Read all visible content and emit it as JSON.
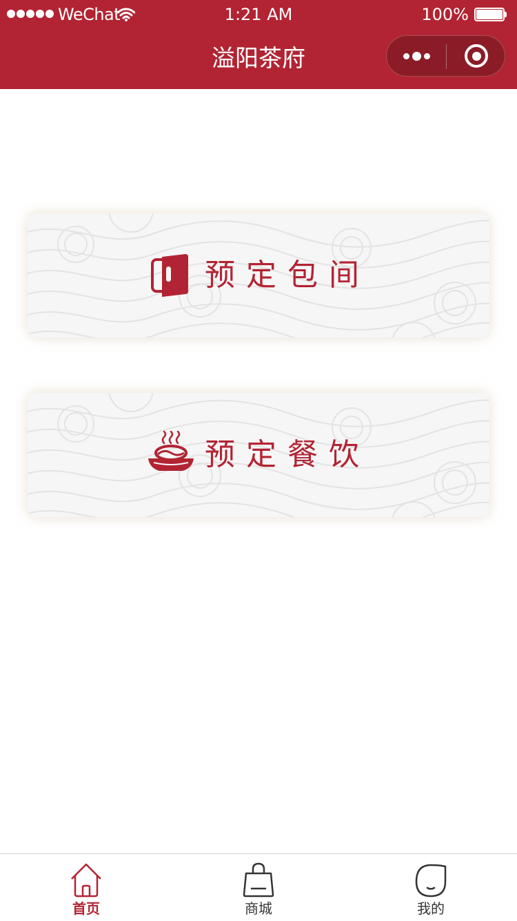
{
  "status_bar": {
    "carrier": "WeChat",
    "time": "1:21 AM",
    "battery": "100%",
    "battery_level": 1.0,
    "signal_bars": 5,
    "icons": [
      "signal-dots-icon",
      "wifi-icon",
      "battery-icon"
    ]
  },
  "nav": {
    "title": "溢阳茶府",
    "capsule_icons": [
      "more-dots-icon",
      "close-target-icon"
    ]
  },
  "cards": [
    {
      "label": "预定包间",
      "icon": "door-icon"
    },
    {
      "label": "预定餐饮",
      "icon": "steaming-bowl-icon"
    }
  ],
  "tabbar": {
    "tabs": [
      {
        "label": "首页",
        "icon": "home-icon",
        "active": true
      },
      {
        "label": "商城",
        "icon": "shopping-bag-icon",
        "active": false
      },
      {
        "label": "我的",
        "icon": "face-profile-icon",
        "active": false
      }
    ]
  },
  "colors": {
    "brand": "#b22433",
    "card_background": "#f6f6f6",
    "tab_inactive": "#333333"
  }
}
